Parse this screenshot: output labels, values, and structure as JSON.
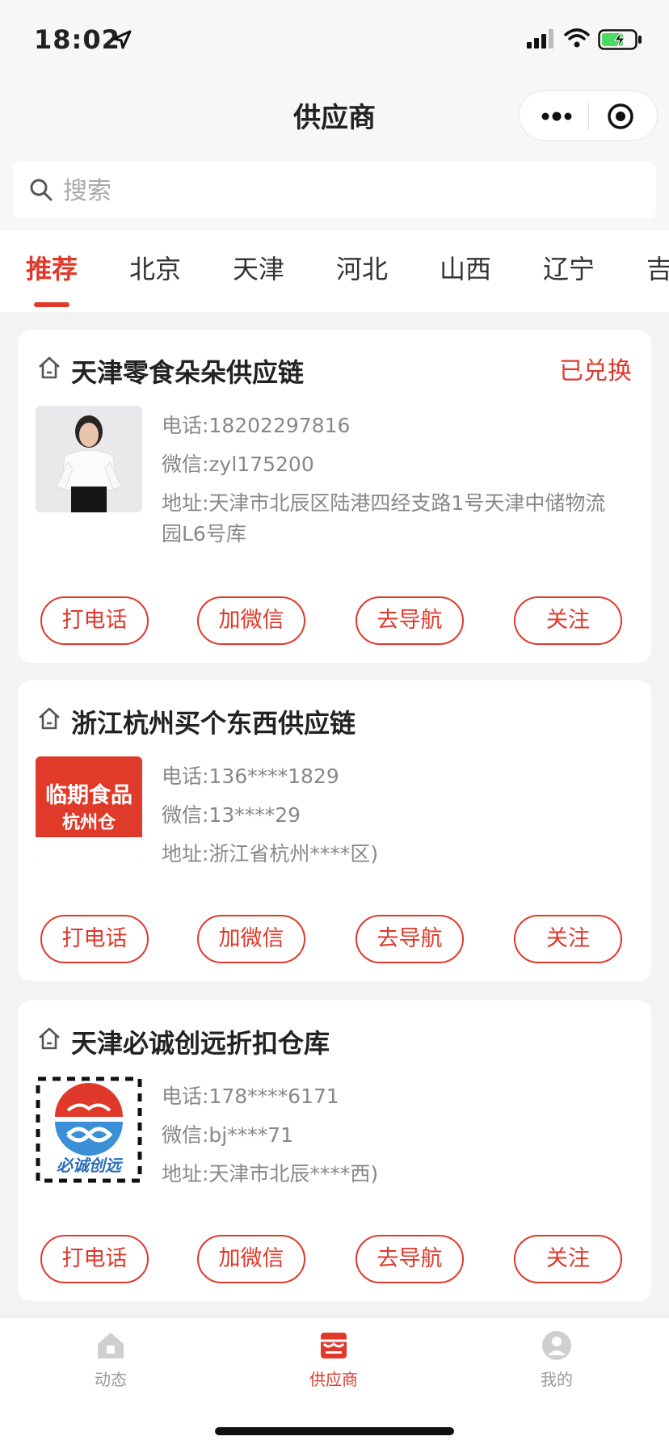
{
  "status_bar": {
    "time": "18:02"
  },
  "nav": {
    "title": "供应商"
  },
  "search": {
    "placeholder": "搜索"
  },
  "tabs": [
    "推荐",
    "北京",
    "天津",
    "河北",
    "山西",
    "辽宁",
    "吉"
  ],
  "active_tab": "推荐",
  "suppliers": [
    {
      "name": "天津零食朵朵供应链",
      "status": "已兑换",
      "phone": "电话:18202297816",
      "wechat": "微信:zyl175200",
      "address": "地址:天津市北辰区陆港四经支路1号天津中储物流园L6号库",
      "buttons": [
        "打电话",
        "加微信",
        "去导航",
        "关注"
      ]
    },
    {
      "name": "浙江杭州买个东西供应链",
      "phone": "电话:136****1829",
      "wechat": "微信:13****29",
      "address": "地址:浙江省杭州****区)",
      "logo_text": [
        "临期食品",
        "杭州仓"
      ],
      "buttons": [
        "打电话",
        "加微信",
        "去导航",
        "关注"
      ]
    },
    {
      "name": "天津必诚创远折扣仓库",
      "phone": "电话:178****6171",
      "wechat": "微信:bj****71",
      "address": "地址:天津市北辰****西)",
      "logo_text": [
        "必诚创远"
      ],
      "buttons": [
        "打电话",
        "加微信",
        "去导航",
        "关注"
      ]
    }
  ],
  "tabbar": [
    {
      "label": "动态",
      "icon": "home-icon"
    },
    {
      "label": "供应商",
      "icon": "store-icon"
    },
    {
      "label": "我的",
      "icon": "user-icon"
    }
  ],
  "colors": {
    "accent": "#e0392b",
    "background": "#f3f3f3"
  }
}
